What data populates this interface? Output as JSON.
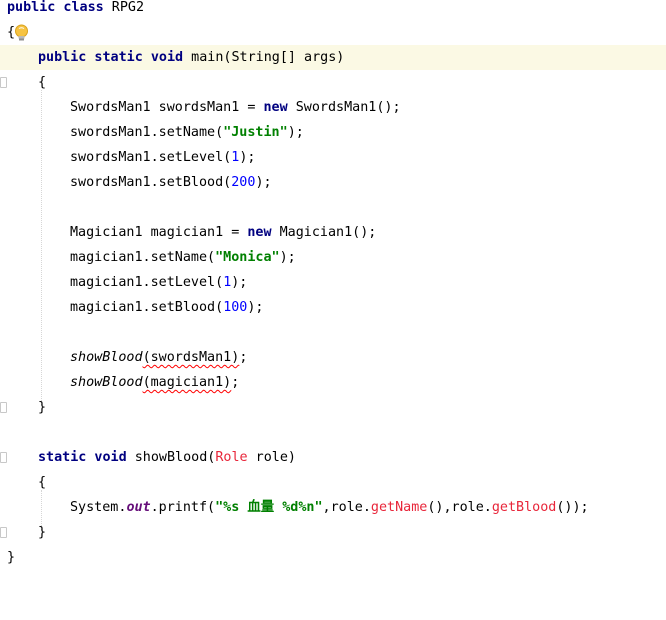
{
  "code": {
    "class_decl": {
      "kw": "public class",
      "name": " RPG2"
    },
    "open_brace": "{",
    "main_decl": {
      "kw": "public static void",
      "rest": " main(String[] args)"
    },
    "main_open": "{",
    "l_swordsman_new": {
      "a": "SwordsMan1 swordsMan1 = ",
      "kw": "new",
      "b": " SwordsMan1();"
    },
    "l_sw_setname": {
      "a": "swordsMan1.setName(",
      "str": "\"Justin\"",
      "b": ");"
    },
    "l_sw_setlevel": {
      "a": "swordsMan1.setLevel(",
      "num": "1",
      "b": ");"
    },
    "l_sw_setblood": {
      "a": "swordsMan1.setBlood(",
      "num": "200",
      "b": ");"
    },
    "l_magician_new": {
      "a": "Magician1 magician1 = ",
      "kw": "new",
      "b": " Magician1();"
    },
    "l_mg_setname": {
      "a": "magician1.setName(",
      "str": "\"Monica\"",
      "b": ");"
    },
    "l_mg_setlevel": {
      "a": "magician1.setLevel(",
      "num": "1",
      "b": ");"
    },
    "l_mg_setblood": {
      "a": "magician1.setBlood(",
      "num": "100",
      "b": ");"
    },
    "l_show1": {
      "m": "showBlood",
      "arg": "(swordsMan1)",
      "b": ";"
    },
    "l_show2": {
      "m": "showBlood",
      "arg": "(magician1)",
      "b": ";"
    },
    "main_close": "}",
    "showblood_decl": {
      "kw": "static void",
      "name": " showBlood(",
      "type": "Role",
      "rest": " role)"
    },
    "showblood_open": "{",
    "l_printf": {
      "a": "System.",
      "field": "out",
      "b": ".printf(",
      "str": "\"%s 血量 %d%n\"",
      "c": ",role.",
      "m1": "getName",
      "d": "(),role.",
      "m2": "getBlood",
      "e": "());"
    },
    "showblood_close": "}",
    "close_brace": "}"
  },
  "icons": {
    "intention": "lightbulb-icon"
  },
  "colors": {
    "keyword": "#000080",
    "string": "#008000",
    "number": "#0000ff",
    "error": "#e8263a",
    "static_field": "#660e7a",
    "caret_line": "#fbf9e4"
  }
}
